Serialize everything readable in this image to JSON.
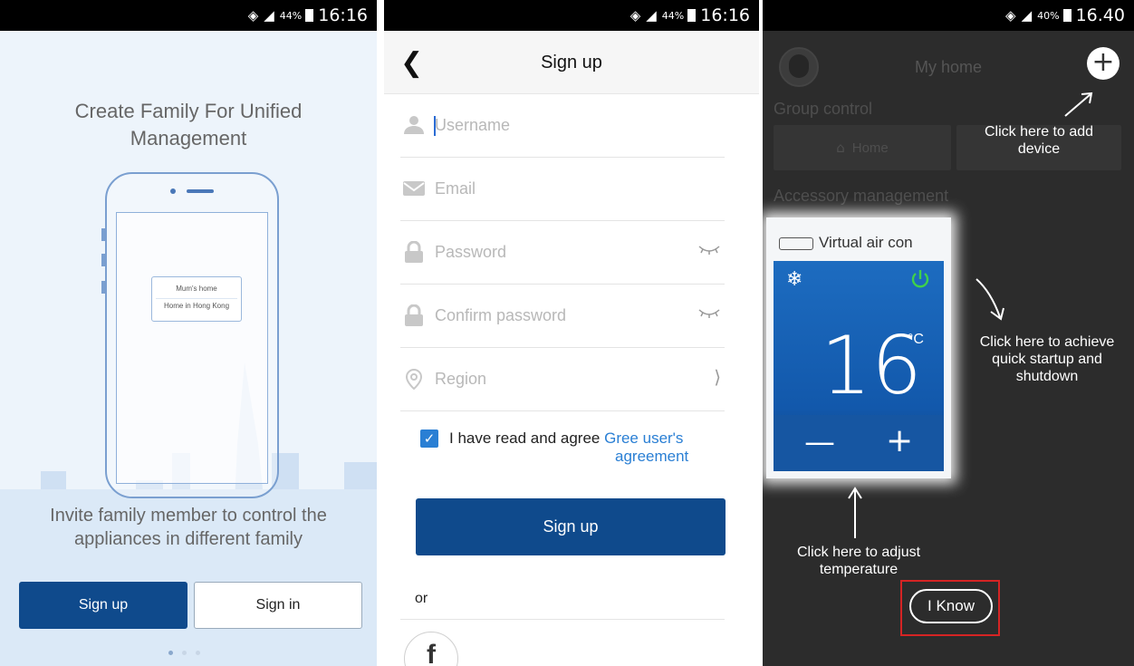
{
  "screen1": {
    "status": {
      "wifi_icon": "wifi-icon",
      "signal_icon": "signal-icon",
      "battery_pct": "44%",
      "time": "16:16"
    },
    "title": "Create Family For Unified Management",
    "card": {
      "item1": "Mum's home",
      "item2": "Home in Hong Kong"
    },
    "invite_text": "Invite family member to control the appliances in different family",
    "signup_label": "Sign up",
    "signin_label": "Sign in"
  },
  "screen2": {
    "status": {
      "battery_pct": "44%",
      "time": "16:16"
    },
    "header_title": "Sign up",
    "fields": {
      "username": "Username",
      "email": "Email",
      "password": "Password",
      "confirm": "Confirm password",
      "region": "Region"
    },
    "agree_text": "I have read and agree",
    "agree_link": "Gree user's",
    "agree_link2": "agreement",
    "signup_button": "Sign up",
    "or_text": "or",
    "fb_glyph": "f"
  },
  "screen3": {
    "status": {
      "battery_pct": "40%",
      "time": "16.40"
    },
    "home_title": "My home",
    "group_control": "Group control",
    "home_tile": "Home",
    "accessory_mgmt": "Accessory management",
    "device_name": "Virtual air con",
    "temperature": "16",
    "temp_unit": "°C",
    "note_add": "Click here to add device",
    "note_power": "Click here to achieve quick startup and shutdown",
    "note_temp": "Click here to adjust temperature",
    "i_know": "I Know",
    "highlight_color": "#d52424"
  }
}
